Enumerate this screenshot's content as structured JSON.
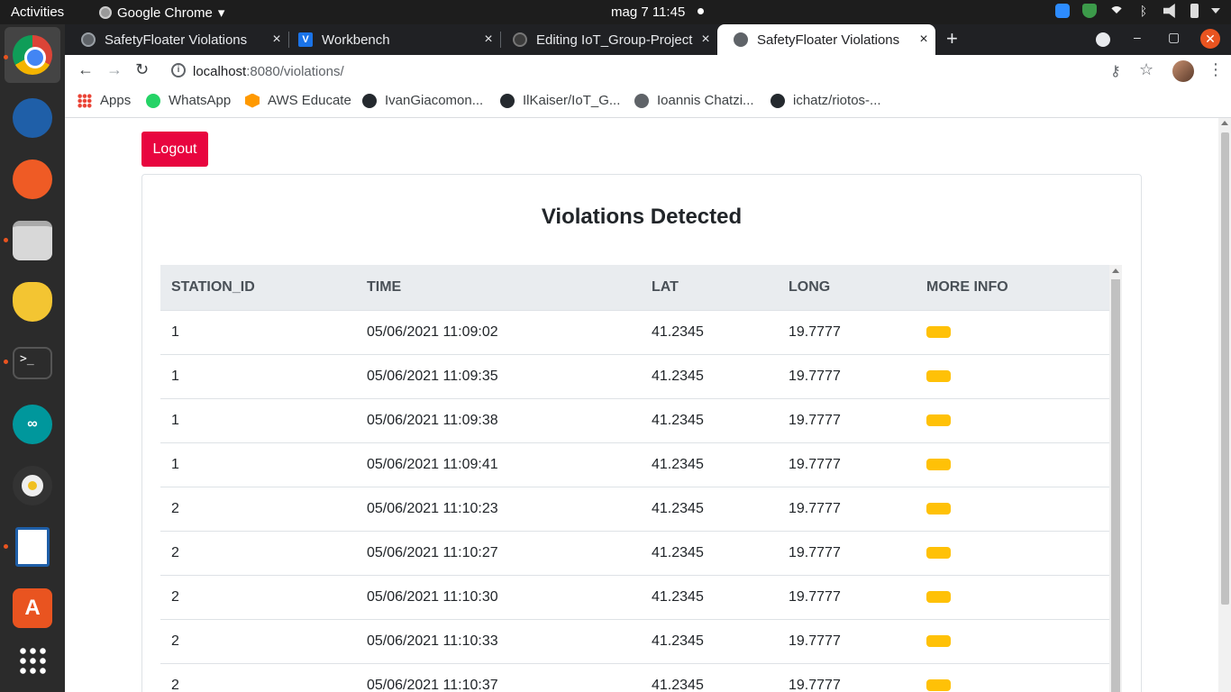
{
  "topbar": {
    "activities": "Activities",
    "app_name": "Google Chrome",
    "clock": "mag 7  11:45"
  },
  "dock": {
    "items": [
      "chrome-icon",
      "thunderbird-icon",
      "postman-icon",
      "files-icon",
      "teapot-icon",
      "terminal-icon",
      "arduino-icon",
      "rhythmbox-icon",
      "writer-icon",
      "software-center-icon",
      "show-apps-icon"
    ],
    "terminal_glyph": ">_",
    "arduino_glyph": "∞",
    "store_glyph": "A"
  },
  "tabs": [
    {
      "title": "SafetyFloater Violations",
      "icon": "globe-icon"
    },
    {
      "title": "Workbench",
      "icon": "workbench-icon"
    },
    {
      "title": "Editing IoT_Group-Project",
      "icon": "github-icon"
    },
    {
      "title": "SafetyFloater Violations",
      "icon": "globe-icon"
    }
  ],
  "tab_close": "×",
  "new_tab": "+",
  "window": {
    "minimize": "–",
    "maximize": "▢",
    "close": "✕"
  },
  "address": {
    "host": "localhost",
    "path": ":8080/violations/"
  },
  "nav": {
    "back": "←",
    "forward": "→",
    "reload": "↻"
  },
  "toolbar_right": {
    "key": "⚷",
    "star": "☆",
    "menu": "⋮"
  },
  "bookmarks": [
    {
      "label": "Apps",
      "icon": "apps-icon"
    },
    {
      "label": "WhatsApp",
      "icon": "whatsapp-icon"
    },
    {
      "label": "AWS Educate",
      "icon": "aws-icon"
    },
    {
      "label": "IvanGiacomon...",
      "icon": "github-icon"
    },
    {
      "label": "IlKaiser/IoT_G...",
      "icon": "github-icon"
    },
    {
      "label": "Ioannis Chatzi...",
      "icon": "globe-icon"
    },
    {
      "label": "ichatz/riotos-...",
      "icon": "github-icon"
    }
  ],
  "page": {
    "logout_label": "Logout",
    "heading": "Violations Detected",
    "columns": [
      "STATION_ID",
      "TIME",
      "LAT",
      "LONG",
      "MORE INFO"
    ],
    "rows": [
      {
        "station_id": "1",
        "time": "05/06/2021 11:09:02",
        "lat": "41.2345",
        "long": "19.7777"
      },
      {
        "station_id": "1",
        "time": "05/06/2021 11:09:35",
        "lat": "41.2345",
        "long": "19.7777"
      },
      {
        "station_id": "1",
        "time": "05/06/2021 11:09:38",
        "lat": "41.2345",
        "long": "19.7777"
      },
      {
        "station_id": "1",
        "time": "05/06/2021 11:09:41",
        "lat": "41.2345",
        "long": "19.7777"
      },
      {
        "station_id": "2",
        "time": "05/06/2021 11:10:23",
        "lat": "41.2345",
        "long": "19.7777"
      },
      {
        "station_id": "2",
        "time": "05/06/2021 11:10:27",
        "lat": "41.2345",
        "long": "19.7777"
      },
      {
        "station_id": "2",
        "time": "05/06/2021 11:10:30",
        "lat": "41.2345",
        "long": "19.7777"
      },
      {
        "station_id": "2",
        "time": "05/06/2021 11:10:33",
        "lat": "41.2345",
        "long": "19.7777"
      },
      {
        "station_id": "2",
        "time": "05/06/2021 11:10:37",
        "lat": "41.2345",
        "long": "19.7777"
      }
    ]
  },
  "colors": {
    "logout": "#e8053f",
    "info_button": "#ffc107",
    "table_header": "#e9ecef"
  }
}
